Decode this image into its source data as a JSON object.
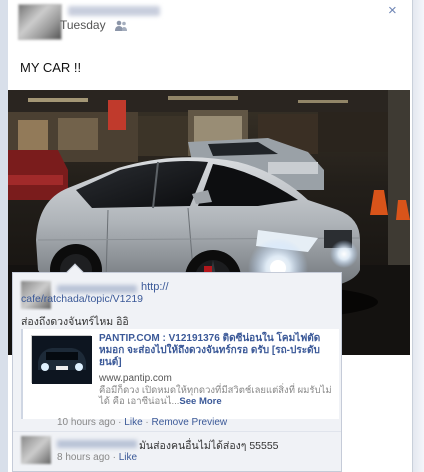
{
  "post": {
    "time": "Tuesday",
    "message": "MY CAR !!",
    "close_label": "×"
  },
  "comments": [
    {
      "link_short": "http://",
      "link_rest": "cafe/ratchada/topic/V1219",
      "text": "ส่องถึงดวงจันทร์ไหม อิอิ",
      "preview": {
        "title": "PANTIP.COM : V12191376 ติดซีน่อนใน โคมไฟตัดหมอก จะส่องไปให้ถึงดวงจันทร์กรอ ดรับ [รถ-ประดับยนต์]",
        "url": "www.pantip.com",
        "description": "คือมีก็ดวง เปิดหมดให้ทุกดวงที่มีสวิตช์เลยแต่สิ่งที่ ผมรับไม่ได้ คือ เอาซีน่อนไ...",
        "see_more": "See More"
      },
      "meta_time": "10 hours ago",
      "like": "Like",
      "remove_preview": "Remove Preview"
    },
    {
      "text": "มันส่องคนอื่นไม่ได้ส่องๆ 55555",
      "meta_time": "8 hours ago",
      "like": "Like"
    }
  ]
}
